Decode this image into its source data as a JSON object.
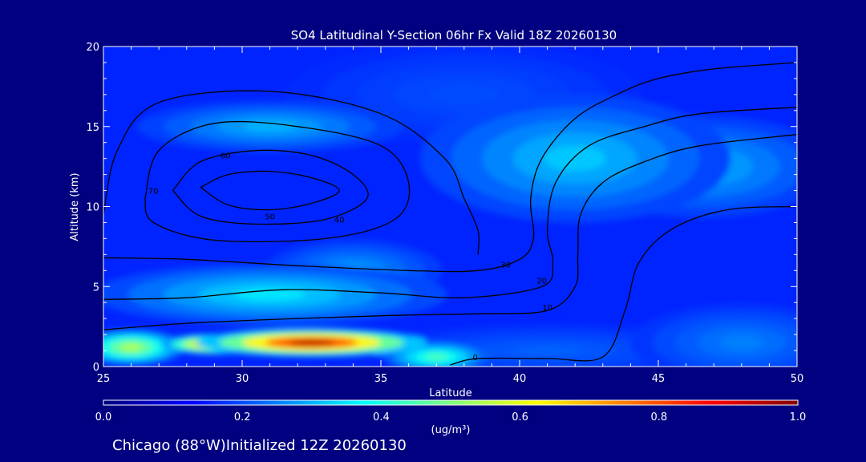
{
  "chart_data": {
    "type": "heatmap",
    "title": "SO4 Latitudinal Y-Section 06hr  Fx Valid 18Z 20260130",
    "xlabel": "Latitude",
    "ylabel": "Altitude (km)",
    "xlim": [
      25,
      50
    ],
    "ylim": [
      0,
      20
    ],
    "x_ticks": [
      "25",
      "30",
      "35",
      "40",
      "45",
      "50"
    ],
    "y_ticks": [
      "0",
      "5",
      "10",
      "15",
      "20"
    ],
    "colorbar": {
      "min": 0.0,
      "max": 1.0,
      "ticks": [
        "0.0",
        "0.2",
        "0.4",
        "0.6",
        "0.8",
        "1.0"
      ],
      "unit": "(ug/m³)",
      "colors": [
        "#00007f",
        "#0000ff",
        "#007fff",
        "#00ffff",
        "#7fff7f",
        "#ffff00",
        "#ff7f00",
        "#ff0000",
        "#7f0000"
      ]
    },
    "concentration_features": [
      {
        "lat": 32.5,
        "alt": 1.5,
        "value": 0.95,
        "sigma_lat": 2.6,
        "sigma_alt": 0.55
      },
      {
        "lat": 29.0,
        "alt": 1.4,
        "value": 0.8,
        "sigma_lat": 1.2,
        "sigma_alt": 0.4
      },
      {
        "lat": 26.0,
        "alt": 1.2,
        "value": 0.55,
        "sigma_lat": 1.2,
        "sigma_alt": 0.7
      },
      {
        "lat": 37.0,
        "alt": 0.6,
        "value": 0.45,
        "sigma_lat": 1.2,
        "sigma_alt": 0.6
      },
      {
        "lat": 31.0,
        "alt": 4.5,
        "value": 0.35,
        "sigma_lat": 4.0,
        "sigma_alt": 1.2
      },
      {
        "lat": 34.0,
        "alt": 6.0,
        "value": 0.28,
        "sigma_lat": 2.0,
        "sigma_alt": 1.2
      },
      {
        "lat": 31.0,
        "alt": 15.0,
        "value": 0.3,
        "sigma_lat": 3.0,
        "sigma_alt": 1.0
      },
      {
        "lat": 42.0,
        "alt": 13.0,
        "value": 0.32,
        "sigma_lat": 3.5,
        "sigma_alt": 2.5
      },
      {
        "lat": 46.5,
        "alt": 12.5,
        "value": 0.3,
        "sigma_lat": 3.0,
        "sigma_alt": 2.0
      },
      {
        "lat": 38.0,
        "alt": 17.0,
        "value": 0.2,
        "sigma_lat": 4.0,
        "sigma_alt": 2.0
      },
      {
        "lat": 41.0,
        "alt": 1.0,
        "value": 0.22,
        "sigma_lat": 4.0,
        "sigma_alt": 1.0
      },
      {
        "lat": 48.0,
        "alt": 1.5,
        "value": 0.25,
        "sigma_lat": 2.5,
        "sigma_alt": 1.5
      }
    ],
    "background_value": 0.16,
    "wind_contours": [
      {
        "value": "70",
        "label_at": [
          26.8,
          10.8
        ],
        "points": [
          [
            28.5,
            11.2
          ],
          [
            29.5,
            12.0
          ],
          [
            31.0,
            12.2
          ],
          [
            32.5,
            11.8
          ],
          [
            33.5,
            11.0
          ],
          [
            32.5,
            10.2
          ],
          [
            31.0,
            9.8
          ],
          [
            29.5,
            10.1
          ],
          [
            28.5,
            11.2
          ]
        ]
      },
      {
        "value": "60",
        "label_at": [
          29.4,
          13.0
        ],
        "points": [
          [
            27.5,
            11.0
          ],
          [
            28.5,
            12.8
          ],
          [
            30.5,
            13.5
          ],
          [
            32.5,
            13.2
          ],
          [
            34.0,
            12.0
          ],
          [
            34.5,
            10.5
          ],
          [
            33.0,
            9.2
          ],
          [
            30.5,
            8.9
          ],
          [
            28.5,
            9.4
          ],
          [
            27.5,
            11.0
          ]
        ]
      },
      {
        "value": "50",
        "label_at": [
          31.0,
          9.2
        ],
        "points": [
          [
            26.5,
            10.5
          ],
          [
            27.0,
            13.5
          ],
          [
            29.0,
            15.2
          ],
          [
            32.0,
            15.0
          ],
          [
            35.0,
            13.8
          ],
          [
            36.0,
            11.5
          ],
          [
            35.5,
            9.2
          ],
          [
            33.0,
            8.0
          ],
          [
            29.0,
            7.9
          ],
          [
            26.8,
            9.0
          ],
          [
            26.5,
            10.5
          ]
        ]
      },
      {
        "value": "40",
        "label_at": [
          33.5,
          9.0
        ],
        "points": [
          [
            25.0,
            9.5
          ],
          [
            25.5,
            13.5
          ],
          [
            27.0,
            16.5
          ],
          [
            31.0,
            17.2
          ],
          [
            35.0,
            15.8
          ],
          [
            37.3,
            13.0
          ],
          [
            38.0,
            10.5
          ],
          [
            38.5,
            8.5
          ],
          [
            38.5,
            7.0
          ]
        ]
      },
      {
        "value": "30",
        "label_at": [
          39.5,
          6.2
        ],
        "points": [
          [
            25.0,
            6.8
          ],
          [
            28.0,
            6.7
          ],
          [
            32.0,
            6.3
          ],
          [
            36.0,
            6.0
          ],
          [
            38.5,
            6.0
          ],
          [
            40.0,
            6.7
          ],
          [
            40.5,
            8.0
          ],
          [
            40.4,
            10.5
          ],
          [
            40.8,
            13.0
          ],
          [
            42.0,
            15.5
          ],
          [
            43.5,
            17.0
          ],
          [
            45.0,
            18.0
          ],
          [
            47.0,
            18.6
          ],
          [
            50.0,
            19.0
          ]
        ]
      },
      {
        "value": "20",
        "label_at": [
          40.8,
          5.2
        ],
        "points": [
          [
            25.0,
            4.2
          ],
          [
            28.0,
            4.3
          ],
          [
            31.5,
            4.8
          ],
          [
            35.0,
            4.6
          ],
          [
            38.0,
            4.3
          ],
          [
            40.8,
            5.0
          ],
          [
            41.2,
            6.5
          ],
          [
            41.0,
            8.5
          ],
          [
            41.3,
            11.5
          ],
          [
            42.5,
            13.8
          ],
          [
            44.5,
            15.0
          ],
          [
            46.5,
            15.8
          ],
          [
            50.0,
            16.2
          ]
        ]
      },
      {
        "value": "10",
        "label_at": [
          41.0,
          3.5
        ],
        "points": [
          [
            25.0,
            2.3
          ],
          [
            28.0,
            2.7
          ],
          [
            32.0,
            3.0
          ],
          [
            35.5,
            3.2
          ],
          [
            38.5,
            3.3
          ],
          [
            41.0,
            3.5
          ],
          [
            42.0,
            5.0
          ],
          [
            42.1,
            7.0
          ],
          [
            42.2,
            9.5
          ],
          [
            43.0,
            11.5
          ],
          [
            44.5,
            12.8
          ],
          [
            46.5,
            13.8
          ],
          [
            50.0,
            14.5
          ]
        ]
      },
      {
        "value": "0",
        "label_at": [
          38.4,
          0.4
        ],
        "points": [
          [
            37.5,
            0.1
          ],
          [
            38.5,
            0.5
          ],
          [
            41.0,
            0.5
          ],
          [
            43.0,
            0.6
          ],
          [
            43.8,
            3.5
          ],
          [
            44.3,
            6.5
          ],
          [
            45.5,
            8.6
          ],
          [
            47.5,
            9.8
          ],
          [
            50.0,
            10.0
          ]
        ]
      }
    ]
  },
  "footer": {
    "text": "Chicago (88°W)Initialized 12Z 20260130"
  }
}
